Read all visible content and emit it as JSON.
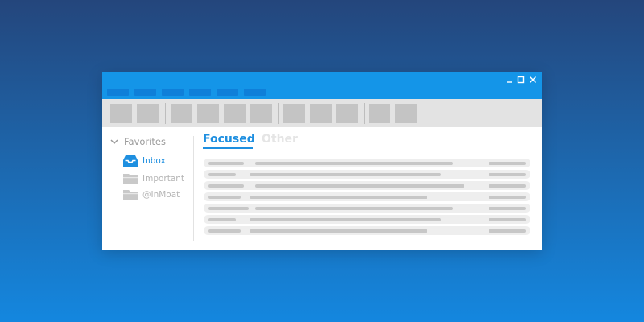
{
  "window": {
    "controls": {
      "minimize": "minimize-icon",
      "maximize": "maximize-icon",
      "close": "close-icon"
    }
  },
  "sidebar": {
    "favorites_label": "Favorites",
    "items": [
      {
        "label": "Inbox",
        "icon": "inbox-tray-icon",
        "selected": true,
        "color": "#1e8fe0"
      },
      {
        "label": "Important",
        "icon": "folder-icon",
        "selected": false,
        "color": "#b5b5b5"
      },
      {
        "label": "@InMoat",
        "icon": "folder-icon",
        "selected": false,
        "color": "#b5b5b5"
      }
    ]
  },
  "tabs": [
    {
      "label": "Focused",
      "active": true
    },
    {
      "label": "Other",
      "active": false
    }
  ],
  "colors": {
    "accent": "#1e8fe0",
    "titlebar": "#1495e8",
    "menu_placeholder": "#0f7fd9",
    "toolbar": "#e3e3e3",
    "toolbar_button": "#c4c4c4"
  }
}
